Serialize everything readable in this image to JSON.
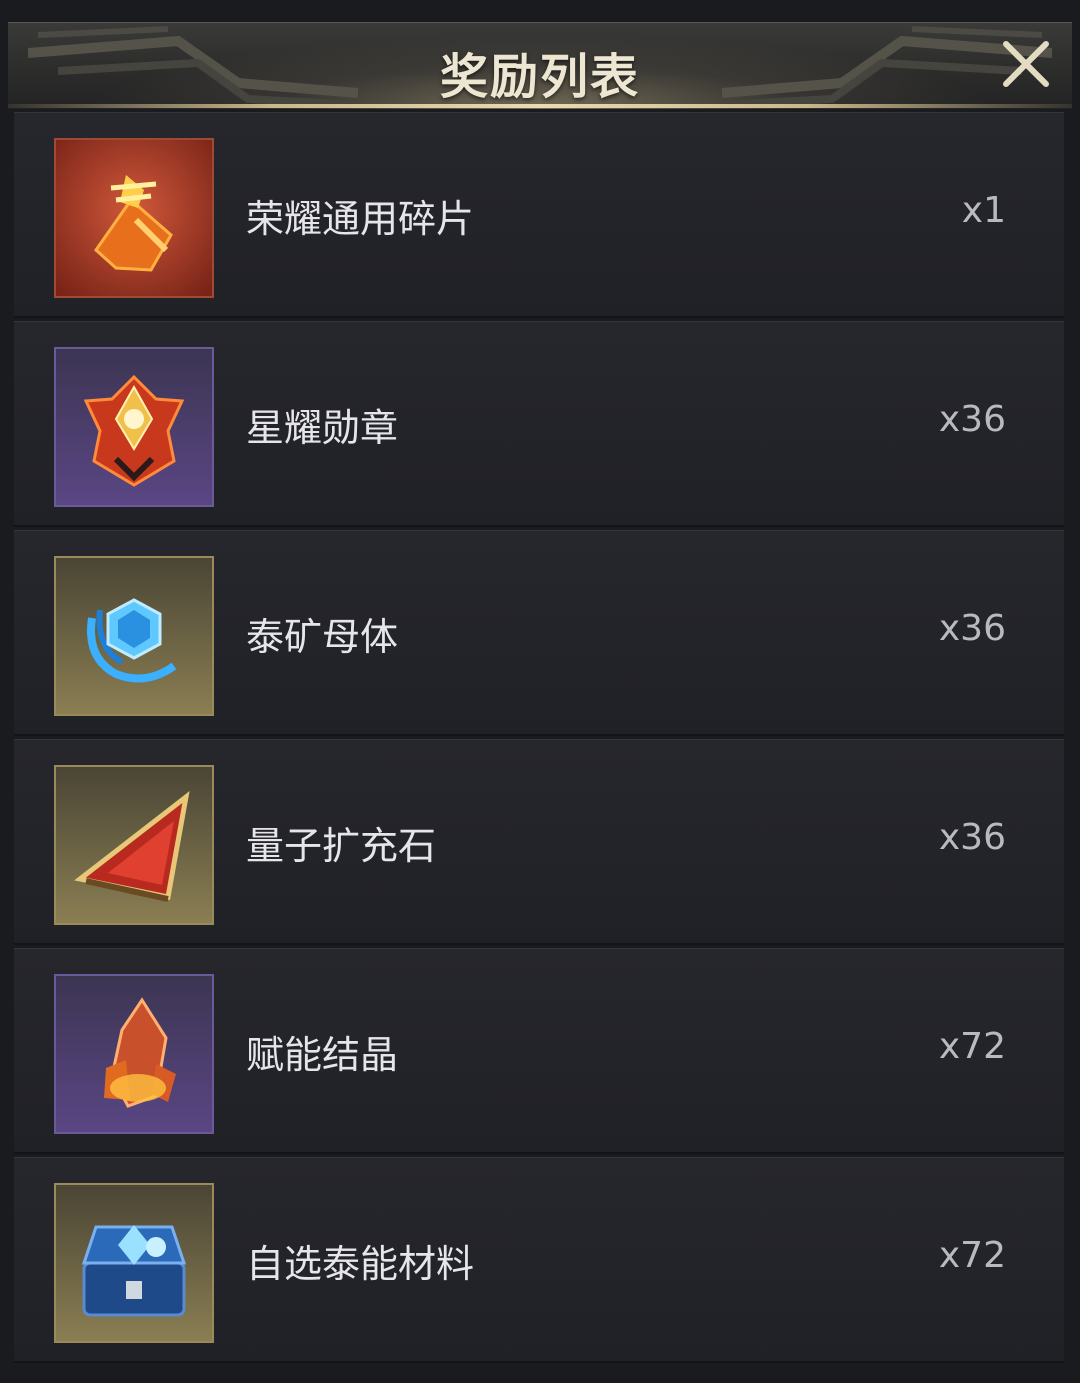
{
  "header": {
    "title": "奖励列表",
    "close_icon": "close-icon"
  },
  "rewards": [
    {
      "name": "荣耀通用碎片",
      "quantity": "x1",
      "icon": "glory-fragment-icon",
      "rarity_color": "#b8402a"
    },
    {
      "name": "星耀勋章",
      "quantity": "x36",
      "icon": "star-medal-icon",
      "rarity_color": "#5a4a8a"
    },
    {
      "name": "泰矿母体",
      "quantity": "x36",
      "icon": "tai-ore-matrix-icon",
      "rarity_color": "#8a7a4a"
    },
    {
      "name": "量子扩充石",
      "quantity": "x36",
      "icon": "quantum-stone-icon",
      "rarity_color": "#8a7a4a"
    },
    {
      "name": "赋能结晶",
      "quantity": "x72",
      "icon": "energy-crystal-icon",
      "rarity_color": "#5a4a8a"
    },
    {
      "name": "自选泰能材料",
      "quantity": "x72",
      "icon": "material-chest-icon",
      "rarity_color": "#8a7a4a"
    }
  ]
}
